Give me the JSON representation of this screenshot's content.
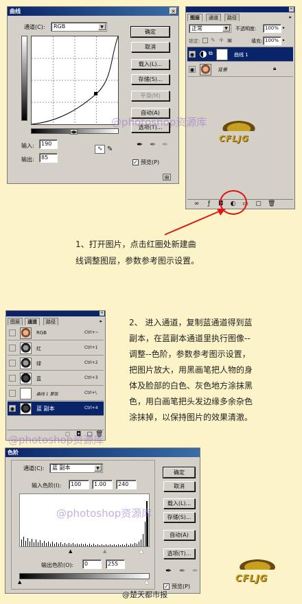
{
  "curves": {
    "title": "曲线",
    "channel_label": "通道(C):",
    "channel_value": "RGB",
    "input_label": "输入:",
    "input_value": "190",
    "output_label": "输出:",
    "output_value": "85",
    "buttons": {
      "ok": "确定",
      "cancel": "取消",
      "load": "载入(L)...",
      "save": "存储(S)...",
      "smooth": "平滑(M)",
      "auto": "自动(A)",
      "options": "选项(T)..."
    },
    "preview_label": "预览(P)",
    "preview_checked": "✓"
  },
  "layers_panel": {
    "tabs": [
      "图层",
      "通道",
      "路径"
    ],
    "blend_mode": "正常",
    "opacity_label": "不透明度:",
    "opacity_value": "100%",
    "lock_label": "锁定:",
    "fill_label": "填充:",
    "fill_value": "100%",
    "layers": [
      {
        "name": "曲线 1",
        "selected": true
      },
      {
        "name": "背景",
        "selected": false
      }
    ]
  },
  "step1": {
    "line1": "1、打开图片，点击红圈处新建曲",
    "line2": "线调整图层，参数参考图示设置。"
  },
  "channels_panel": {
    "tabs": [
      "图层",
      "通道",
      "路径"
    ],
    "rows": [
      {
        "name": "RGB",
        "shortcut": "Ctrl+~"
      },
      {
        "name": "红",
        "shortcut": "Ctrl+1"
      },
      {
        "name": "绿",
        "shortcut": "Ctrl+2"
      },
      {
        "name": "蓝",
        "shortcut": "Ctrl+3"
      },
      {
        "name": "曲线 1 蒙版",
        "shortcut": "Ctrl+\\"
      },
      {
        "name": "蓝 副本",
        "shortcut": "Ctrl+4"
      }
    ]
  },
  "step2": {
    "lines": [
      "2、  进入通道，复制蓝通道得到蓝",
      "副本，在蓝副本通道里执行图像--",
      "调整--色阶，参数参考图示设置，",
      "把图片放大，用黑画笔把人物的身",
      "体及脸部的白色、灰色地方涂抹黑",
      "色，用白画笔把头发边缘多余杂色",
      "涂抹掉，以保持图片的效果清澈。"
    ]
  },
  "levels": {
    "title": "色阶",
    "channel_label": "通道(C):",
    "channel_value": "蓝 副本",
    "input_label": "输入色阶(I):",
    "input_values": [
      "100",
      "1.00",
      "240"
    ],
    "output_label": "输出色阶(O):",
    "output_values": [
      "0",
      "255"
    ],
    "buttons": {
      "ok": "确定",
      "cancel": "取消",
      "load": "载入(L)...",
      "save": "存储(S)...",
      "auto": "自动(A)",
      "options": "选项(T)..."
    },
    "preview_label": "预览(P)",
    "preview_checked": "✓"
  },
  "watermarks": {
    "text1": "@photoshop资源库",
    "text2": "@photoshop资源库",
    "text3": "@photoshop资源库",
    "logo": "CFLJG",
    "weibo": "@楚天都市报"
  }
}
